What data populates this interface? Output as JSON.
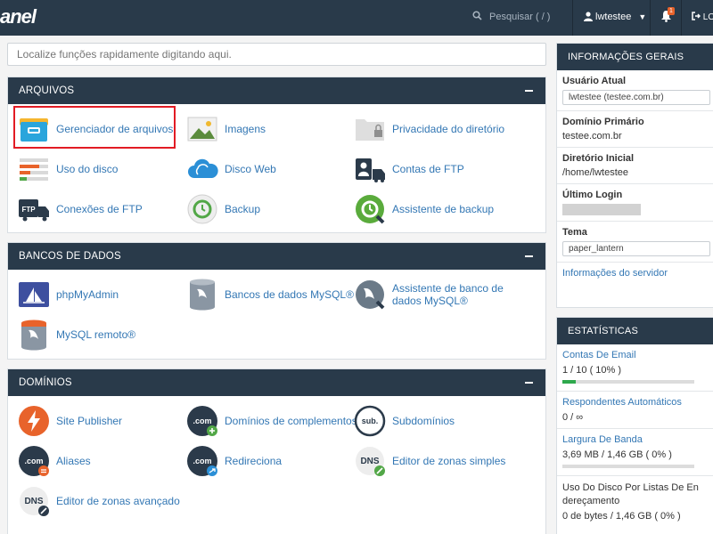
{
  "header": {
    "logo_text": "anel",
    "search_placeholder": "Pesquisar ( / )",
    "user": "lwtestee",
    "notification_count": "1",
    "logout_label": "LO"
  },
  "quick_search": {
    "placeholder": "Localize funções rapidamente digitando aqui."
  },
  "panels": {
    "arquivos": {
      "title": "ARQUIVOS",
      "items": [
        "Gerenciador de arquivos",
        "Imagens",
        "Privacidade do diretório",
        "Uso do disco",
        "Disco Web",
        "Contas de FTP",
        "Conexões de FTP",
        "Backup",
        "Assistente de backup"
      ]
    },
    "bancos": {
      "title": "BANCOS DE DADOS",
      "items": [
        "phpMyAdmin",
        "Bancos de dados MySQL®",
        "Assistente de banco de dados MySQL®",
        "MySQL remoto®"
      ]
    },
    "dominios": {
      "title": "DOMÍNIOS",
      "items": [
        "Site Publisher",
        "Domínios de complementos",
        "Subdomínios",
        "Aliases",
        "Redireciona",
        "Editor de zonas simples",
        "Editor de zonas avançado"
      ],
      "icon_text": {
        "com": ".com",
        "sub": "sub.",
        "dns": "DNS",
        "ftp": "FTP"
      }
    }
  },
  "info": {
    "title": "INFORMAÇÕES GERAIS",
    "usuario_label": "Usuário Atual",
    "usuario_value": "lwtestee (testee.com.br)",
    "dominio_label": "Domínio Primário",
    "dominio_value": "testee.com.br",
    "diretorio_label": "Diretório Inicial",
    "diretorio_value": "/home/lwtestee",
    "login_label": "Último Login",
    "tema_label": "Tema",
    "tema_value": "paper_lantern",
    "server_link": "Informações do servidor"
  },
  "stats": {
    "title": "ESTATÍSTICAS",
    "email_label": "Contas De Email",
    "email_value": "1 / 10 ( 10% )",
    "email_percent": 10,
    "resp_label": "Respondentes Automáticos",
    "resp_value": "0 / ∞",
    "band_label": "Largura De Banda",
    "band_value": "3,69 MB / 1,46 GB ( 0% )",
    "band_percent": 0,
    "disk_label": "Uso Do Disco Por Listas De En dereçamento",
    "disk_value": "0 de bytes / 1,46 GB ( 0% )"
  },
  "colors": {
    "topbar": "#293a4a",
    "link": "#3377b4",
    "highlight": "#e21b24",
    "progress": "#2ea84c"
  }
}
